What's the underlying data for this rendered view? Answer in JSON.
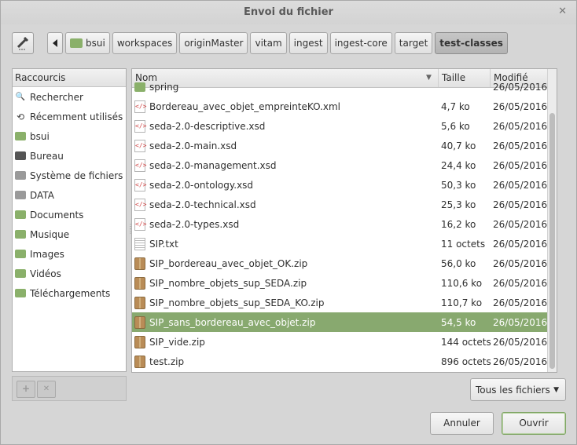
{
  "window": {
    "title": "Envoi du fichier",
    "close_glyph": "✕"
  },
  "toolbar": {
    "edit_icon": "pencil-icon",
    "back_icon": "triangle-left-icon"
  },
  "breadcrumbs": [
    "bsui",
    "workspaces",
    "originMaster",
    "vitam",
    "ingest",
    "ingest-core",
    "target",
    "test-classes"
  ],
  "breadcrumbs_active_index": 7,
  "places": {
    "header": "Raccourcis",
    "items": [
      {
        "label": "Rechercher",
        "icon": "search-icon"
      },
      {
        "label": "Récemment utilisés",
        "icon": "recent-icon"
      },
      {
        "label": "bsui",
        "icon": "home-folder-icon"
      },
      {
        "label": "Bureau",
        "icon": "desktop-icon"
      },
      {
        "label": "Système de fichiers",
        "icon": "drive-icon"
      },
      {
        "label": "DATA",
        "icon": "drive-icon"
      },
      {
        "label": "Documents",
        "icon": "folder-icon"
      },
      {
        "label": "Musique",
        "icon": "music-folder-icon"
      },
      {
        "label": "Images",
        "icon": "pictures-folder-icon"
      },
      {
        "label": "Vidéos",
        "icon": "video-folder-icon"
      },
      {
        "label": "Téléchargements",
        "icon": "downloads-folder-icon"
      }
    ],
    "add_glyph": "+",
    "remove_glyph": "✕"
  },
  "files": {
    "columns": {
      "name": "Nom",
      "size": "Taille",
      "modified": "Modifié"
    },
    "sort_glyph": "▼",
    "rows": [
      {
        "name": "spring",
        "size": "",
        "modified": "26/05/2016",
        "type": "folder"
      },
      {
        "name": "Bordereau_avec_objet_empreinteKO.xml",
        "size": "4,7 ko",
        "modified": "26/05/2016",
        "type": "xml"
      },
      {
        "name": "seda-2.0-descriptive.xsd",
        "size": "5,6 ko",
        "modified": "26/05/2016",
        "type": "xml"
      },
      {
        "name": "seda-2.0-main.xsd",
        "size": "40,7 ko",
        "modified": "26/05/2016",
        "type": "xml"
      },
      {
        "name": "seda-2.0-management.xsd",
        "size": "24,4 ko",
        "modified": "26/05/2016",
        "type": "xml"
      },
      {
        "name": "seda-2.0-ontology.xsd",
        "size": "50,3 ko",
        "modified": "26/05/2016",
        "type": "xml"
      },
      {
        "name": "seda-2.0-technical.xsd",
        "size": "25,3 ko",
        "modified": "26/05/2016",
        "type": "xml"
      },
      {
        "name": "seda-2.0-types.xsd",
        "size": "16,2 ko",
        "modified": "26/05/2016",
        "type": "xml"
      },
      {
        "name": "SIP.txt",
        "size": "11 octets",
        "modified": "26/05/2016",
        "type": "txt"
      },
      {
        "name": "SIP_bordereau_avec_objet_OK.zip",
        "size": "56,0 ko",
        "modified": "26/05/2016",
        "type": "zip"
      },
      {
        "name": "SIP_nombre_objets_sup_SEDA.zip",
        "size": "110,6 ko",
        "modified": "26/05/2016",
        "type": "zip"
      },
      {
        "name": "SIP_nombre_objets_sup_SEDA_KO.zip",
        "size": "110,7 ko",
        "modified": "26/05/2016",
        "type": "zip"
      },
      {
        "name": "SIP_sans_bordereau_avec_objet.zip",
        "size": "54,5 ko",
        "modified": "26/05/2016",
        "type": "zip",
        "selected": true
      },
      {
        "name": "SIP_vide.zip",
        "size": "144 octets",
        "modified": "26/05/2016",
        "type": "zip"
      },
      {
        "name": "test.zip",
        "size": "896 octets",
        "modified": "26/05/2016",
        "type": "zip"
      }
    ]
  },
  "filter": {
    "value": "Tous les fichiers",
    "caret": "▼"
  },
  "buttons": {
    "cancel": "Annuler",
    "open": "Ouvrir"
  },
  "colors": {
    "selection": "#88a96f",
    "xml_accent": "#d24a4a",
    "folder": "#8ab06a"
  }
}
